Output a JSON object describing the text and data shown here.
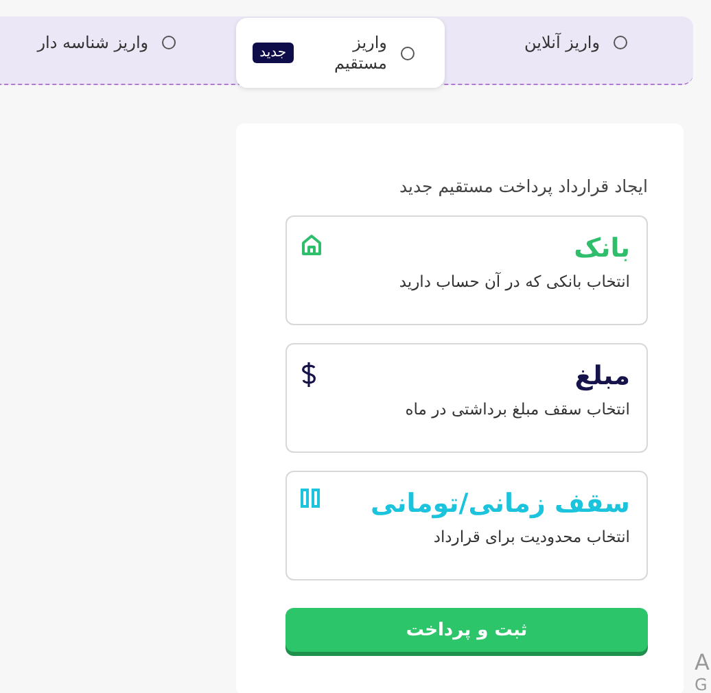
{
  "deposit_tabs": [
    {
      "label": "واریز آنلاین",
      "selected": false,
      "checked": false
    },
    {
      "label": "واریز مستقیم",
      "selected": true,
      "checked": false,
      "badge": "جدید"
    },
    {
      "label": "واریز شناسه دار",
      "selected": false,
      "checked": false
    }
  ],
  "form": {
    "title": "ایجاد قرارداد پرداخت مستقیم جدید",
    "options": [
      {
        "kind": "bank",
        "title": "بانک",
        "description": "انتخاب بانکی که در آن حساب دارید",
        "color": "#2fbf6c"
      },
      {
        "kind": "amount",
        "title": "مبلغ",
        "description": "انتخاب سقف مبلغ برداشتی در ماه",
        "color": "#16124a"
      },
      {
        "kind": "limit",
        "title": "سقف زمانی/تومانی",
        "description": "انتخاب محدودیت برای قرارداد",
        "color": "#1cc3dc"
      }
    ],
    "submit": "ثبت و پرداخت"
  },
  "edge_texts": [
    "A",
    "G"
  ]
}
